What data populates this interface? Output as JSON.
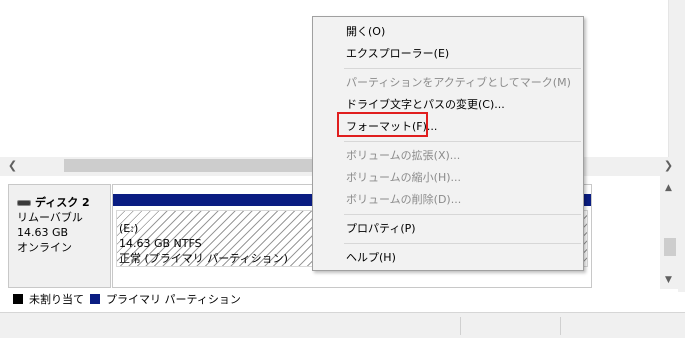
{
  "disk": {
    "name": "ディスク 2",
    "type": "リムーバブル",
    "size": "14.63 GB",
    "status": "オンライン"
  },
  "partition": {
    "letter": "(E:)",
    "fs": "14.63 GB NTFS",
    "health": "正常 (プライマリ パーティション)"
  },
  "legend": {
    "unallocated": "未割り当て",
    "primary": "プライマリ パーティション"
  },
  "menu": {
    "open": "開く(O)",
    "explorer": "エクスプローラー(E)",
    "mark_active": "パーティションをアクティブとしてマーク(M)",
    "change_letter": "ドライブ文字とパスの変更(C)...",
    "format": "フォーマット(F)...",
    "extend": "ボリュームの拡張(X)...",
    "shrink": "ボリュームの縮小(H)...",
    "delete": "ボリュームの削除(D)...",
    "properties": "プロパティ(P)",
    "help": "ヘルプ(H)"
  },
  "colors": {
    "primary_partition": "#0a1d82",
    "unallocated": "#000000",
    "highlight": "#e01e1e"
  }
}
